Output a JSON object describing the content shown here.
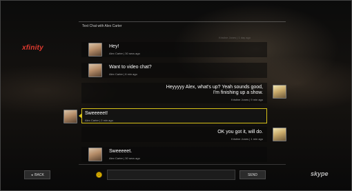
{
  "brand": {
    "xfinity": "xfinity",
    "skype": "skype"
  },
  "header": {
    "title": "Text Chat with Alex Carter"
  },
  "faded": {
    "top_meta": "Kristine Jones | 1 day ago"
  },
  "messages": [
    {
      "author": "Alex Carter",
      "side": "left",
      "text": "Hey!",
      "meta": "Alex Carter | 30 secs ago"
    },
    {
      "author": "Alex Carter",
      "side": "left",
      "text": "Want to video chat?",
      "meta": "Alex Carter | 6 min ago"
    },
    {
      "author": "Kristine Jones",
      "side": "right",
      "text_line1": "Heyyyyy Alex, what's up? Yeah sounds good,",
      "text_line2": "I'm finishing up a show.",
      "meta": "Kristine Jones | 9 min ago"
    },
    {
      "author": "Alex Carter",
      "side": "left",
      "text": "Sweeeeet!",
      "meta": "Alex Carter | 2 min ago",
      "selected": true
    },
    {
      "author": "Kristine Jones",
      "side": "right",
      "text": "OK you got it, will do.",
      "meta": "Kristine Jones | 1 min ago"
    },
    {
      "author": "Alex Carter",
      "side": "left",
      "text": "Sweeeeet.",
      "meta": "Alex Carter | 30 secs ago"
    }
  ],
  "footer": {
    "back_label": "BACK",
    "send_label": "SEND",
    "input_value": "",
    "emoji_glyph": "☺"
  },
  "colors": {
    "accent_selected": "#d8c219",
    "xfinity_red": "#e23a2f"
  },
  "icons": {
    "back": "back-arrow-icon",
    "emoji": "smiley-icon"
  }
}
